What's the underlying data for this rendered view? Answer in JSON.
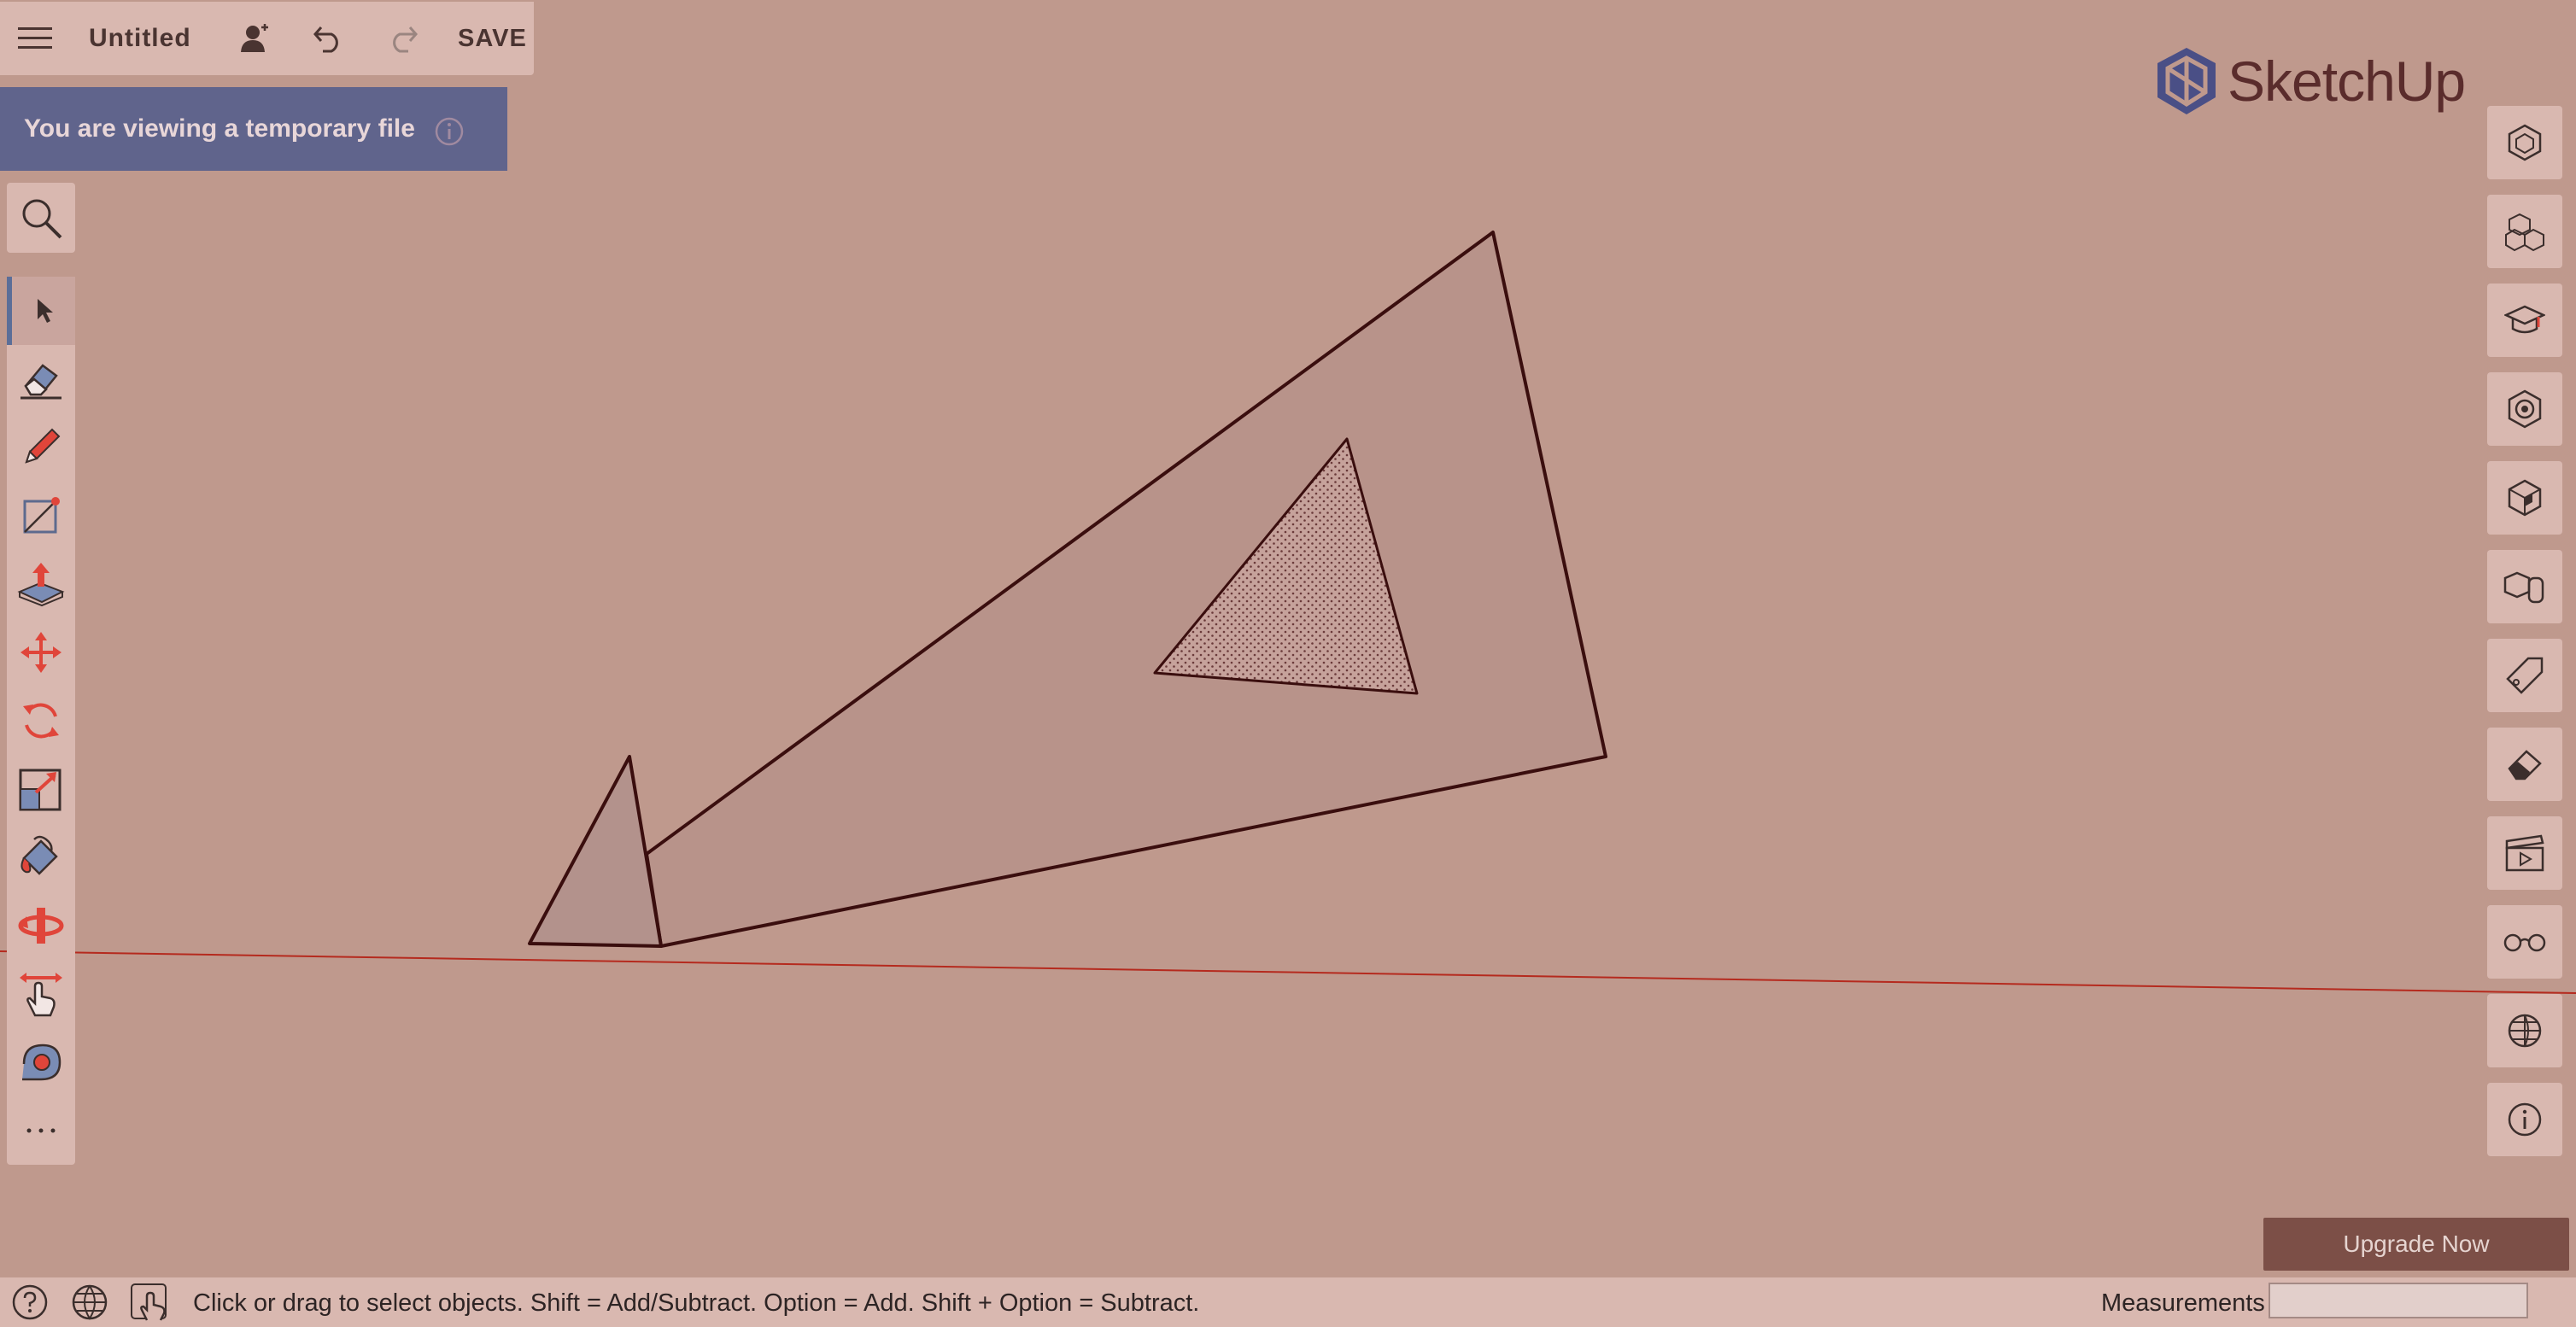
{
  "app": {
    "file_title": "Untitled",
    "save_label": "SAVE",
    "brand": "SketchUp"
  },
  "banner": {
    "text": "You are viewing a temporary file"
  },
  "tools": [
    {
      "name": "select-tool",
      "icon": "arrow-cursor-icon",
      "active": true
    },
    {
      "name": "eraser-tool",
      "icon": "eraser-icon"
    },
    {
      "name": "pencil-tool",
      "icon": "pencil-icon"
    },
    {
      "name": "line-tool",
      "icon": "line-icon"
    },
    {
      "name": "push-pull-tool",
      "icon": "push-pull-icon"
    },
    {
      "name": "move-tool",
      "icon": "move-icon"
    },
    {
      "name": "rotate-tool",
      "icon": "rotate-icon"
    },
    {
      "name": "scale-tool",
      "icon": "scale-icon"
    },
    {
      "name": "paint-tool",
      "icon": "paint-bucket-icon"
    },
    {
      "name": "orbit-tool",
      "icon": "orbit-icon"
    },
    {
      "name": "pan-tool",
      "icon": "pan-icon"
    },
    {
      "name": "tape-tool",
      "icon": "tape-measure-icon"
    },
    {
      "name": "more-tools",
      "icon": "ellipsis-icon"
    }
  ],
  "right_panels": [
    {
      "name": "entity-info-panel",
      "icon": "entity-icon"
    },
    {
      "name": "components-panel",
      "icon": "components-icon"
    },
    {
      "name": "instructor-panel",
      "icon": "graduation-cap-icon"
    },
    {
      "name": "materials-panel",
      "icon": "materials-icon"
    },
    {
      "name": "styles-panel",
      "icon": "styles-icon"
    },
    {
      "name": "outliner-panel",
      "icon": "outliner-icon"
    },
    {
      "name": "tags-panel",
      "icon": "tag-icon"
    },
    {
      "name": "soften-panel",
      "icon": "eraser-soft-icon"
    },
    {
      "name": "scenes-panel",
      "icon": "clapperboard-icon"
    },
    {
      "name": "display-panel",
      "icon": "glasses-icon"
    },
    {
      "name": "geo-panel",
      "icon": "globe-grid-icon"
    },
    {
      "name": "info-panel",
      "icon": "info-icon"
    }
  ],
  "upgrade": {
    "label": "Upgrade Now"
  },
  "status": {
    "hint": "Click or drag to select objects. Shift = Add/Subtract. Option = Add. Shift + Option = Subtract.",
    "measurements_label": "Measurements",
    "measurements_value": ""
  },
  "colors": {
    "canvas": "#bf998d",
    "panel": "#d9b8b0",
    "banner": "#60648c",
    "upgrade": "#7c4f47",
    "edge": "#3a0e0e",
    "axis_red": "#b52a1e"
  }
}
